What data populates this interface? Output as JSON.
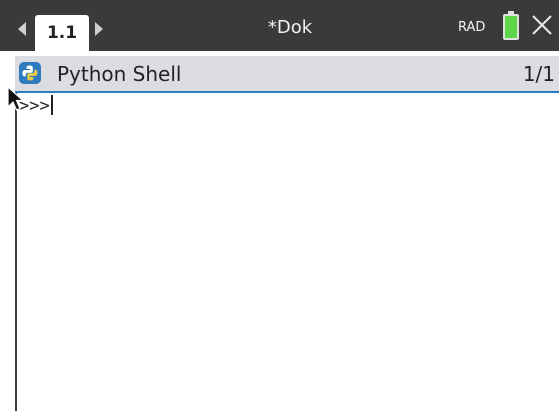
{
  "tab_bar": {
    "active_tab_label": "1.1",
    "prev_icon": "triangle-left-icon",
    "next_icon": "triangle-right-icon",
    "document_title": "*Dok",
    "angle_mode": "RAD",
    "battery_icon": "battery-icon",
    "close_icon": "close-icon"
  },
  "header": {
    "app_icon": "python-icon",
    "title": "Python Shell",
    "page_indicator": "1/1"
  },
  "shell": {
    "prompt": ">>>",
    "input_value": ""
  },
  "colors": {
    "topbar": "#3a3a3a",
    "header_bg": "#dcdde3",
    "accent": "#2f7bbf",
    "battery": "#5dd64a"
  }
}
